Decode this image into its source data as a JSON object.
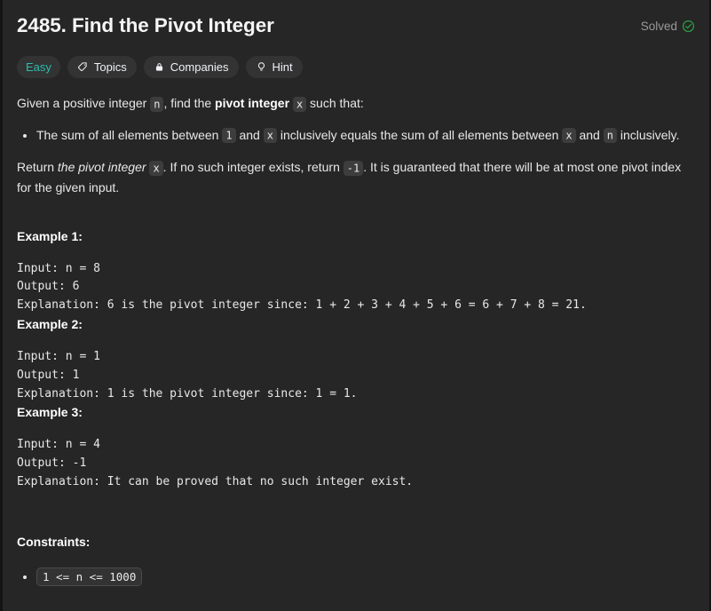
{
  "header": {
    "title": "2485. Find the Pivot Integer",
    "status_label": "Solved",
    "status_icon": "check-circle-icon",
    "status_color": "#2ea043"
  },
  "tags": [
    {
      "label": "Easy",
      "icon": null,
      "color": "#2cbcad"
    },
    {
      "label": "Topics",
      "icon": "tag-icon",
      "color": "#eff1f6"
    },
    {
      "label": "Companies",
      "icon": "lock-icon",
      "color": "#eff1f6"
    },
    {
      "label": "Hint",
      "icon": "lightbulb-icon",
      "color": "#eff1f6"
    }
  ],
  "description": {
    "intro_part1": "Given a positive integer ",
    "intro_code_n": "n",
    "intro_part2": ", find the ",
    "intro_bold": "pivot integer",
    "intro_part3": " ",
    "intro_code_x": "x",
    "intro_part4": " such that:",
    "bullet_part1": "The sum of all elements between ",
    "bullet_code_1": "1",
    "bullet_part2": " and ",
    "bullet_code_x1": "x",
    "bullet_part3": " inclusively equals the sum of all elements between ",
    "bullet_code_x2": "x",
    "bullet_part4": " and ",
    "bullet_code_n": "n",
    "bullet_part5": " inclusively.",
    "return_part1": "Return ",
    "return_italic": "the pivot integer",
    "return_part2": " ",
    "return_code_x": "x",
    "return_part3": ". If no such integer exists, return ",
    "return_code_neg1": "-1",
    "return_part4": ". It is guaranteed that there will be at most one pivot index for the given input."
  },
  "examples": [
    {
      "title": "Example 1:",
      "body": "Input: n = 8\nOutput: 6\nExplanation: 6 is the pivot integer since: 1 + 2 + 3 + 4 + 5 + 6 = 6 + 7 + 8 = 21."
    },
    {
      "title": "Example 2:",
      "body": "Input: n = 1\nOutput: 1\nExplanation: 1 is the pivot integer since: 1 = 1."
    },
    {
      "title": "Example 3:",
      "body": "Input: n = 4\nOutput: -1\nExplanation: It can be proved that no such integer exist."
    }
  ],
  "constraints": {
    "title": "Constraints:",
    "items": [
      "1 <= n <= 1000"
    ]
  }
}
